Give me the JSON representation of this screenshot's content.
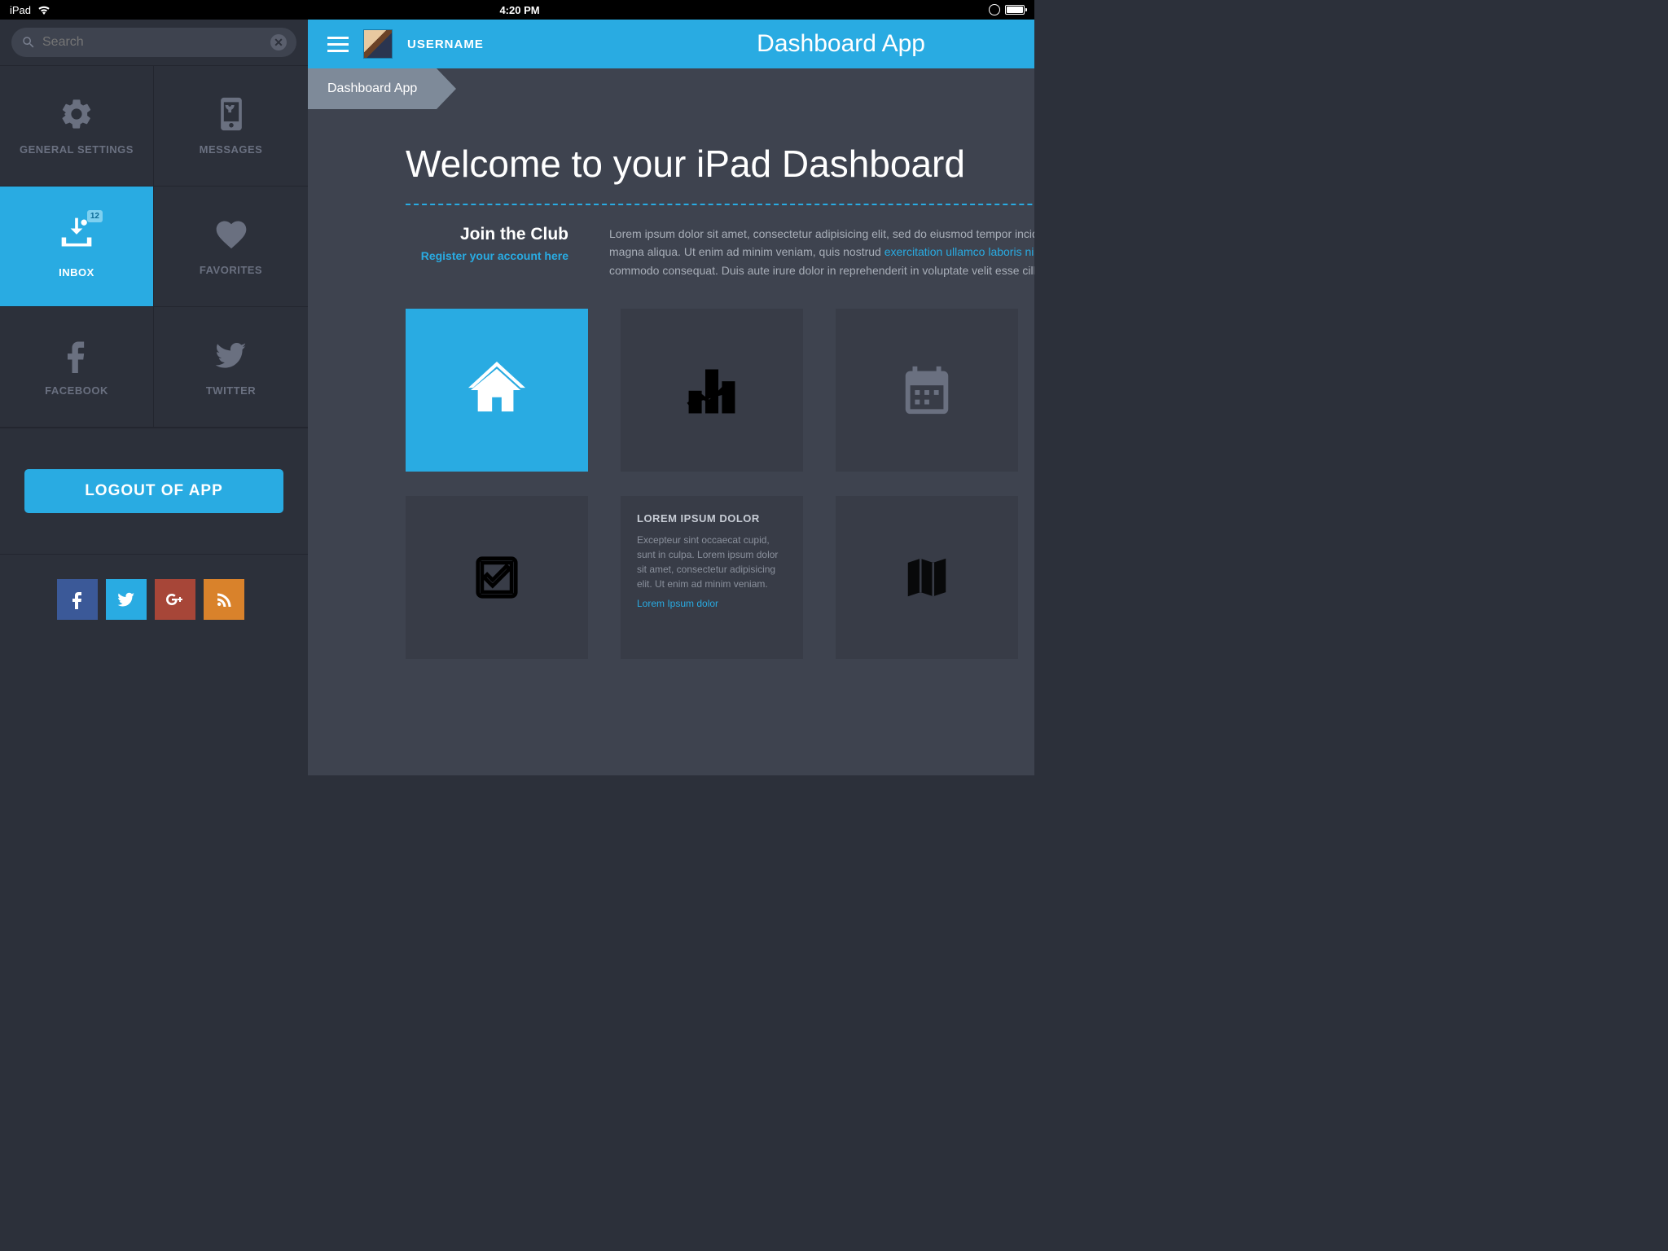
{
  "statusbar": {
    "device": "iPad",
    "time": "4:20 PM"
  },
  "sidebar": {
    "search": {
      "placeholder": "Search"
    },
    "items": [
      {
        "label": "GENERAL SETTINGS"
      },
      {
        "label": "MESSAGES"
      },
      {
        "label": "INBOX",
        "badge": "12"
      },
      {
        "label": "FAVORITES"
      },
      {
        "label": "FACEBOOK"
      },
      {
        "label": "TWITTER"
      }
    ],
    "logout": "LOGOUT OF APP"
  },
  "header": {
    "username": "USERNAME",
    "title": "Dashboard App"
  },
  "breadcrumb": {
    "item": "Dashboard App"
  },
  "content": {
    "welcome": "Welcome to your iPad Dashboard",
    "intro": {
      "heading": "Join the Club",
      "link": "Register your account here",
      "p1": "Lorem ipsum dolor sit amet, consectetur adipisicing elit, sed do eiusmod tempor incididunt ut labore et dolore",
      "p2a": "magna aliqua. Ut enim ad minim veniam, quis nostrud ",
      "p2b": "exercitation ullamco laboris nisi ut aliquip ex ea",
      "p3": "commodo consequat. Duis aute irure dolor in reprehenderit in voluptate velit esse cillum dolore eu fugiat nulla"
    },
    "card": {
      "title": "LOREM IPSUM DOLOR",
      "body": "Excepteur sint occaecat cupid, sunt in culpa. Lorem ipsum dolor sit amet, consectetur adipisicing elit. Ut enim ad minim veniam.",
      "link": "Lorem Ipsum dolor"
    }
  }
}
